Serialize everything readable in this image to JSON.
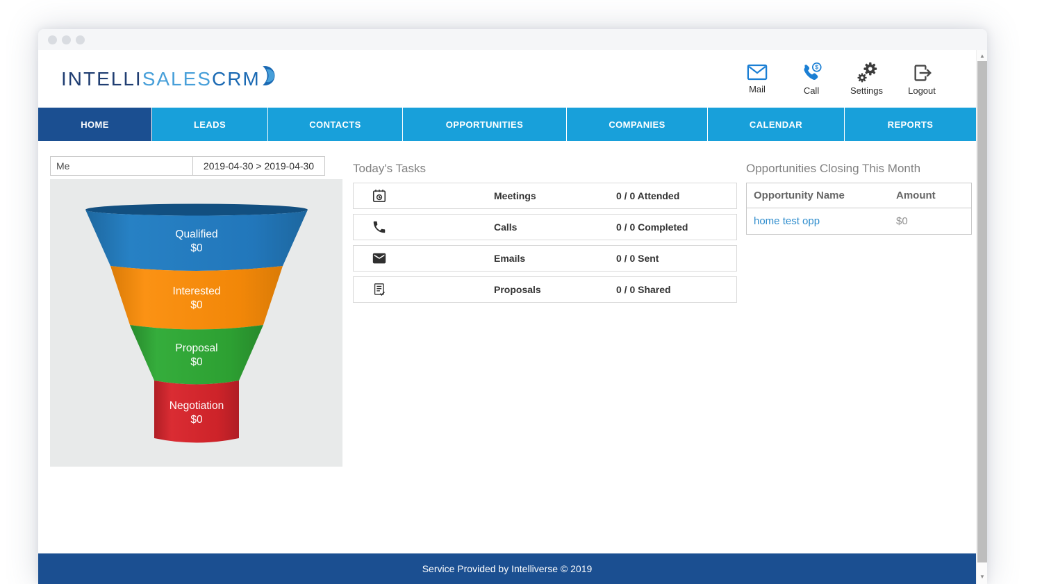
{
  "header": {
    "logo": {
      "part1": "INTELLI",
      "part2": "SALES",
      "part3": "CRM"
    },
    "actions": [
      {
        "icon": "mail-icon",
        "label": "Mail"
      },
      {
        "icon": "call-icon",
        "label": "Call"
      },
      {
        "icon": "settings-icon",
        "label": "Settings"
      },
      {
        "icon": "logout-icon",
        "label": "Logout"
      }
    ]
  },
  "nav": {
    "active": "HOME",
    "items": [
      {
        "label": "HOME"
      },
      {
        "label": "LEADS"
      },
      {
        "label": "CONTACTS"
      },
      {
        "label": "OPPORTUNITIES"
      },
      {
        "label": "COMPANIES"
      },
      {
        "label": "CALENDAR"
      },
      {
        "label": "REPORTS"
      }
    ]
  },
  "filters": {
    "owner": "Me",
    "date_range": "2019-04-30 > 2019-04-30"
  },
  "chart_data": {
    "type": "funnel",
    "segments": [
      {
        "label": "Qualified",
        "value": "$0",
        "amount": 0,
        "color": "#2478bc"
      },
      {
        "label": "Interested",
        "value": "$0",
        "amount": 0,
        "color": "#f68a10"
      },
      {
        "label": "Proposal",
        "value": "$0",
        "amount": 0,
        "color": "#2fa235"
      },
      {
        "label": "Negotiation",
        "value": "$0",
        "amount": 0,
        "color": "#d1262d"
      }
    ],
    "background": "#e8eaea"
  },
  "tasks": {
    "title": "Today's Tasks",
    "rows": [
      {
        "icon": "meeting-calendar-icon",
        "label": "Meetings",
        "status": "0 / 0 Attended"
      },
      {
        "icon": "phone-icon",
        "label": "Calls",
        "status": "0 / 0 Completed"
      },
      {
        "icon": "envelope-icon",
        "label": "Emails",
        "status": "0 / 0 Sent"
      },
      {
        "icon": "proposal-document-icon",
        "label": "Proposals",
        "status": "0 / 0 Shared"
      }
    ]
  },
  "opportunities": {
    "title": "Opportunities Closing This Month",
    "columns": {
      "name": "Opportunity Name",
      "amount": "Amount"
    },
    "rows": [
      {
        "name": "home test opp",
        "amount": "$0"
      }
    ]
  },
  "footer": {
    "text": "Service Provided by Intelliverse © 2019"
  },
  "colors": {
    "nav_active": "#1b4f91",
    "nav_default": "#18a0da",
    "footer_bar": "#1b4f91",
    "link": "#2f8dcd",
    "icon_blue": "#1b7fd4",
    "logo_dark": "#203e72",
    "logo_light": "#479fd9"
  }
}
